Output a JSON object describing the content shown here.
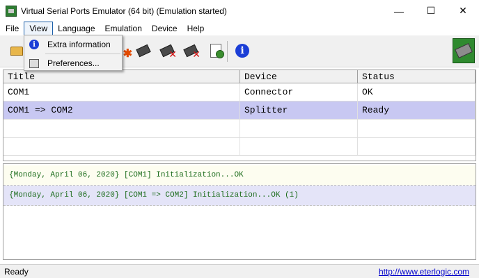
{
  "window": {
    "title": "Virtual Serial Ports Emulator (64 bit) (Emulation started)",
    "minimize": "—",
    "maximize": "☐",
    "close": "✕"
  },
  "menu": {
    "items": [
      "File",
      "View",
      "Language",
      "Emulation",
      "Device",
      "Help"
    ],
    "open": "View",
    "dropdown": [
      "Extra information",
      "Preferences..."
    ]
  },
  "toolbar": {
    "icons": [
      "open-folder-icon",
      "device-icon",
      "add-device-icon",
      "device-settings-icon",
      "delete-device-icon",
      "delete-all-devices-icon",
      "log-settings-icon",
      "info-icon"
    ]
  },
  "table": {
    "columns": [
      "Title",
      "Device",
      "Status"
    ],
    "rows": [
      [
        "COM1",
        "Connector",
        "OK"
      ],
      [
        "COM1 => COM2",
        "Splitter",
        "Ready"
      ]
    ],
    "selected_row": 1
  },
  "log": {
    "lines": [
      "{Monday, April 06, 2020} [COM1] Initialization...OK",
      "{Monday, April 06, 2020} [COM1 => COM2] Initialization...OK (1)"
    ]
  },
  "status": {
    "text": "Ready",
    "link": "http://www.eterlogic.com"
  },
  "colors": {
    "selected_row": "#c8c8f2",
    "log_text": "#1a6b1a",
    "link": "#0000cc"
  }
}
